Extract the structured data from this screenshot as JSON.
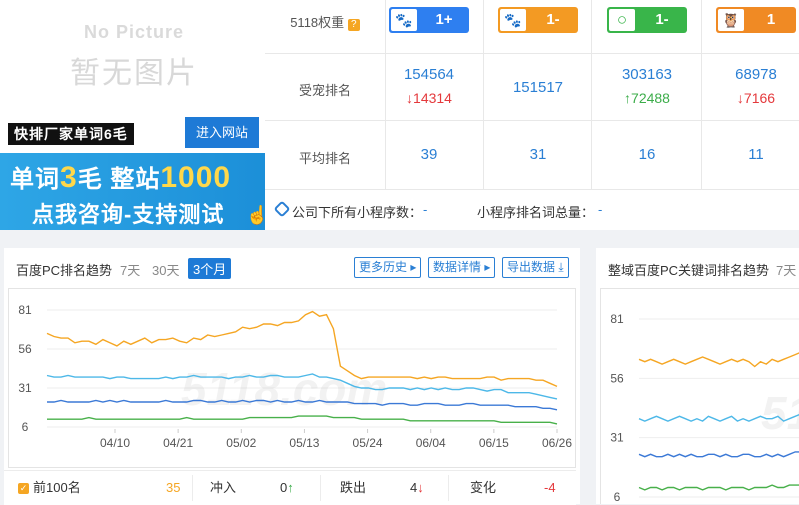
{
  "promo": {
    "no_picture_en": "No Picture",
    "no_picture_cn": "暂无图片",
    "black_label": "快排厂家单词6毛",
    "enter_button": "进入网站",
    "banner_a": "单词",
    "banner_b": "3",
    "banner_c": "毛  整站",
    "banner_d": "1000",
    "banner_line2": "点我咨询-支持测试"
  },
  "metrics": {
    "weight_label": "5118权重",
    "weight_icon": "question-badge",
    "rank_label": "受宠排名",
    "avg_label": "平均排名",
    "engines": [
      {
        "icon": "paw-icon",
        "glyph": "🐾",
        "color": "#2e7ff0",
        "weight": "1+",
        "rank": "154564",
        "change": "14314",
        "dir": "down",
        "avg": "39"
      },
      {
        "icon": "paw-icon",
        "glyph": "🐾",
        "color": "#f39a23",
        "weight": "1-",
        "rank": "151517",
        "change": "",
        "dir": "",
        "avg": "31"
      },
      {
        "icon": "ring-icon",
        "glyph": "○",
        "color": "#39b54a",
        "weight": "1-",
        "rank": "303163",
        "change": "72488",
        "dir": "up",
        "avg": "16"
      },
      {
        "icon": "owl-icon",
        "glyph": "🦉",
        "color": "#f08a24",
        "weight": "1",
        "rank": "68978",
        "change": "7166",
        "dir": "down",
        "avg": "11"
      }
    ],
    "mini_company_label": "公司下所有小程序数：",
    "mini_company_value": "-",
    "mini_words_label": "小程序排名词总量：",
    "mini_words_value": "-"
  },
  "left_panel": {
    "title": "百度PC排名趋势",
    "ranges": [
      "7天",
      "30天",
      "3个月"
    ],
    "active_range": "3个月",
    "buttons": [
      "更多历史",
      "数据详情",
      "导出数据"
    ],
    "bottom": {
      "top100_label": "前100名",
      "top100_value": "35",
      "rush_label": "冲入",
      "rush_value": "0",
      "drop_label": "跌出",
      "drop_value": "4",
      "change_label": "变化",
      "change_value": "-4"
    }
  },
  "right_panel": {
    "title": "整域百度PC关键词排名趋势",
    "range_first": "7天"
  },
  "watermark": "5118.com",
  "chart_data": [
    {
      "type": "line",
      "yticks": [
        6,
        31,
        56,
        81
      ],
      "ylim": [
        6,
        81
      ],
      "x_ticks": [
        "04/10",
        "04/21",
        "05/02",
        "05/13",
        "05/24",
        "06/04",
        "06/15",
        "06/26"
      ],
      "series": [
        {
          "color": "#f5a623",
          "values": [
            66,
            64,
            63,
            63,
            60,
            61,
            61,
            59,
            62,
            60,
            58,
            61,
            59,
            61,
            63,
            60,
            62,
            62,
            63,
            61,
            60,
            63,
            62,
            65,
            64,
            65,
            66,
            67,
            70,
            69,
            70,
            72,
            72,
            71,
            73,
            73,
            74,
            78,
            80,
            77,
            78,
            69,
            45,
            42,
            39,
            37,
            38,
            38,
            38,
            38,
            38,
            38,
            38,
            37,
            38,
            37,
            38,
            38,
            37,
            37,
            37,
            37,
            37,
            38,
            38,
            36,
            37,
            37,
            37,
            37,
            36,
            36,
            34,
            32
          ]
        },
        {
          "color": "#4db8e8",
          "values": [
            39,
            38,
            38,
            39,
            38,
            38,
            38,
            38,
            38,
            37,
            38,
            38,
            37,
            37,
            37,
            37,
            37,
            38,
            37,
            38,
            38,
            39,
            38,
            38,
            38,
            38,
            37,
            38,
            38,
            39,
            38,
            38,
            39,
            39,
            38,
            38,
            38,
            39,
            40,
            38,
            38,
            37,
            36,
            34,
            32,
            31,
            31,
            30,
            30,
            31,
            31,
            31,
            30,
            31,
            30,
            31,
            30,
            31,
            30,
            30,
            31,
            31,
            30,
            29,
            30,
            30,
            28,
            28,
            28,
            28,
            27,
            26,
            25,
            24
          ]
        },
        {
          "color": "#3b79d6",
          "values": [
            22,
            22,
            23,
            22,
            22,
            22,
            22,
            23,
            22,
            23,
            22,
            23,
            22,
            22,
            22,
            22,
            22,
            23,
            22,
            22,
            22,
            23,
            23,
            22,
            22,
            23,
            22,
            22,
            23,
            22,
            23,
            23,
            22,
            23,
            22,
            22,
            23,
            22,
            22,
            23,
            22,
            22,
            22,
            22,
            21,
            21,
            21,
            21,
            20,
            21,
            21,
            21,
            20,
            20,
            21,
            21,
            21,
            20,
            20,
            20,
            21,
            21,
            20,
            20,
            20,
            20,
            20,
            19,
            19,
            19,
            19,
            18,
            18,
            17
          ]
        },
        {
          "color": "#48b04a",
          "values": [
            11,
            11,
            11,
            11,
            11,
            11,
            12,
            11,
            11,
            11,
            11,
            11,
            11,
            11,
            11,
            11,
            11,
            11,
            11,
            11,
            12,
            11,
            11,
            11,
            11,
            11,
            11,
            11,
            11,
            12,
            12,
            12,
            12,
            12,
            12,
            12,
            13,
            13,
            13,
            13,
            13,
            12,
            12,
            12,
            12,
            11,
            11,
            11,
            11,
            11,
            11,
            11,
            10,
            10,
            10,
            10,
            10,
            10,
            10,
            10,
            10,
            10,
            10,
            10,
            10,
            9,
            9,
            9,
            9,
            9,
            9,
            9,
            9,
            8
          ]
        }
      ]
    },
    {
      "type": "line",
      "yticks": [
        6,
        31,
        56,
        81
      ],
      "ylim": [
        6,
        81
      ],
      "series": [
        {
          "color": "#f5a623",
          "values": [
            64,
            63,
            64,
            63,
            62,
            63,
            64,
            63,
            62,
            63,
            64,
            65,
            64,
            63,
            62,
            63,
            64,
            63,
            64,
            63,
            61,
            63,
            62,
            64,
            63,
            64,
            65,
            66,
            67
          ]
        },
        {
          "color": "#4db8e8",
          "values": [
            39,
            38,
            39,
            40,
            39,
            38,
            39,
            40,
            39,
            38,
            39,
            38,
            40,
            39,
            38,
            39,
            40,
            38,
            39,
            38,
            39,
            40,
            39,
            39,
            40,
            38,
            39,
            40,
            41
          ]
        },
        {
          "color": "#3b79d6",
          "values": [
            24,
            23,
            24,
            23,
            23,
            24,
            23,
            24,
            23,
            24,
            23,
            23,
            24,
            24,
            23,
            24,
            23,
            23,
            24,
            24,
            23,
            23,
            24,
            23,
            24,
            23,
            24,
            25,
            25
          ]
        },
        {
          "color": "#48b04a",
          "values": [
            10,
            9,
            10,
            10,
            9,
            10,
            10,
            9,
            10,
            10,
            10,
            9,
            10,
            10,
            10,
            9,
            10,
            10,
            10,
            9,
            10,
            10,
            10,
            11,
            10,
            10,
            11,
            11,
            11
          ]
        }
      ]
    }
  ]
}
